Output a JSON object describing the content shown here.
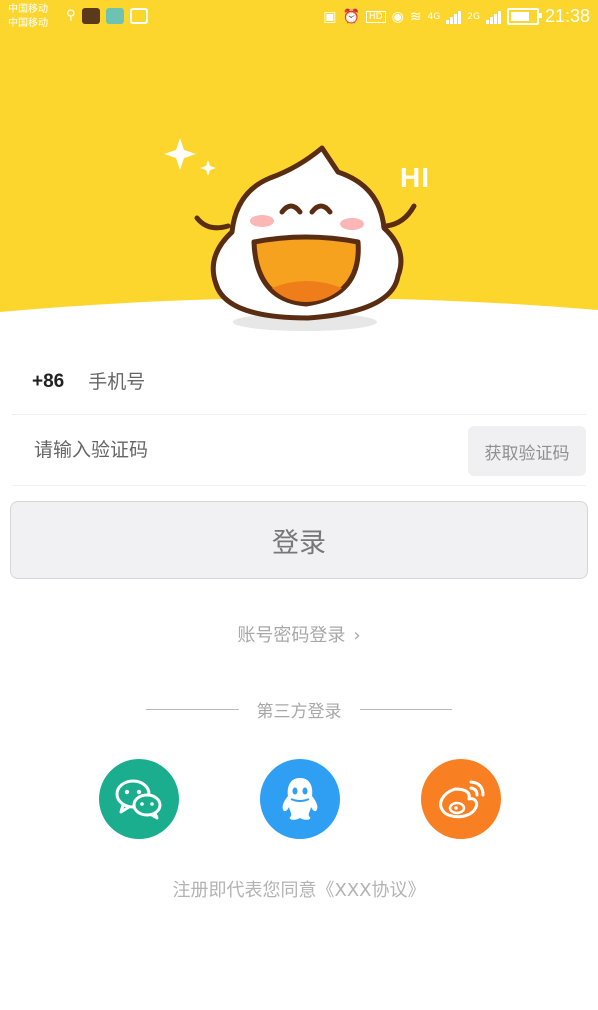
{
  "status_bar": {
    "carrier_1": "中国移动",
    "carrier_2": "中国移动",
    "network_1": "4G",
    "network_2": "2G",
    "time": "21:38"
  },
  "hero": {
    "greeting": "HI",
    "background_color": "#fdd62d"
  },
  "form": {
    "country_code": "+86",
    "phone_placeholder": "手机号",
    "code_placeholder": "请输入验证码",
    "get_code_label": "获取验证码",
    "login_label": "登录"
  },
  "password_login_label": "账号密码登录",
  "third_party": {
    "label": "第三方登录",
    "providers": [
      {
        "icon": "wechat-icon",
        "color": "#1aad8e"
      },
      {
        "icon": "qq-icon",
        "color": "#2e9ff2"
      },
      {
        "icon": "weibo-icon",
        "color": "#f87f22"
      }
    ]
  },
  "agreement_text": "注册即代表您同意《XXX协议》"
}
